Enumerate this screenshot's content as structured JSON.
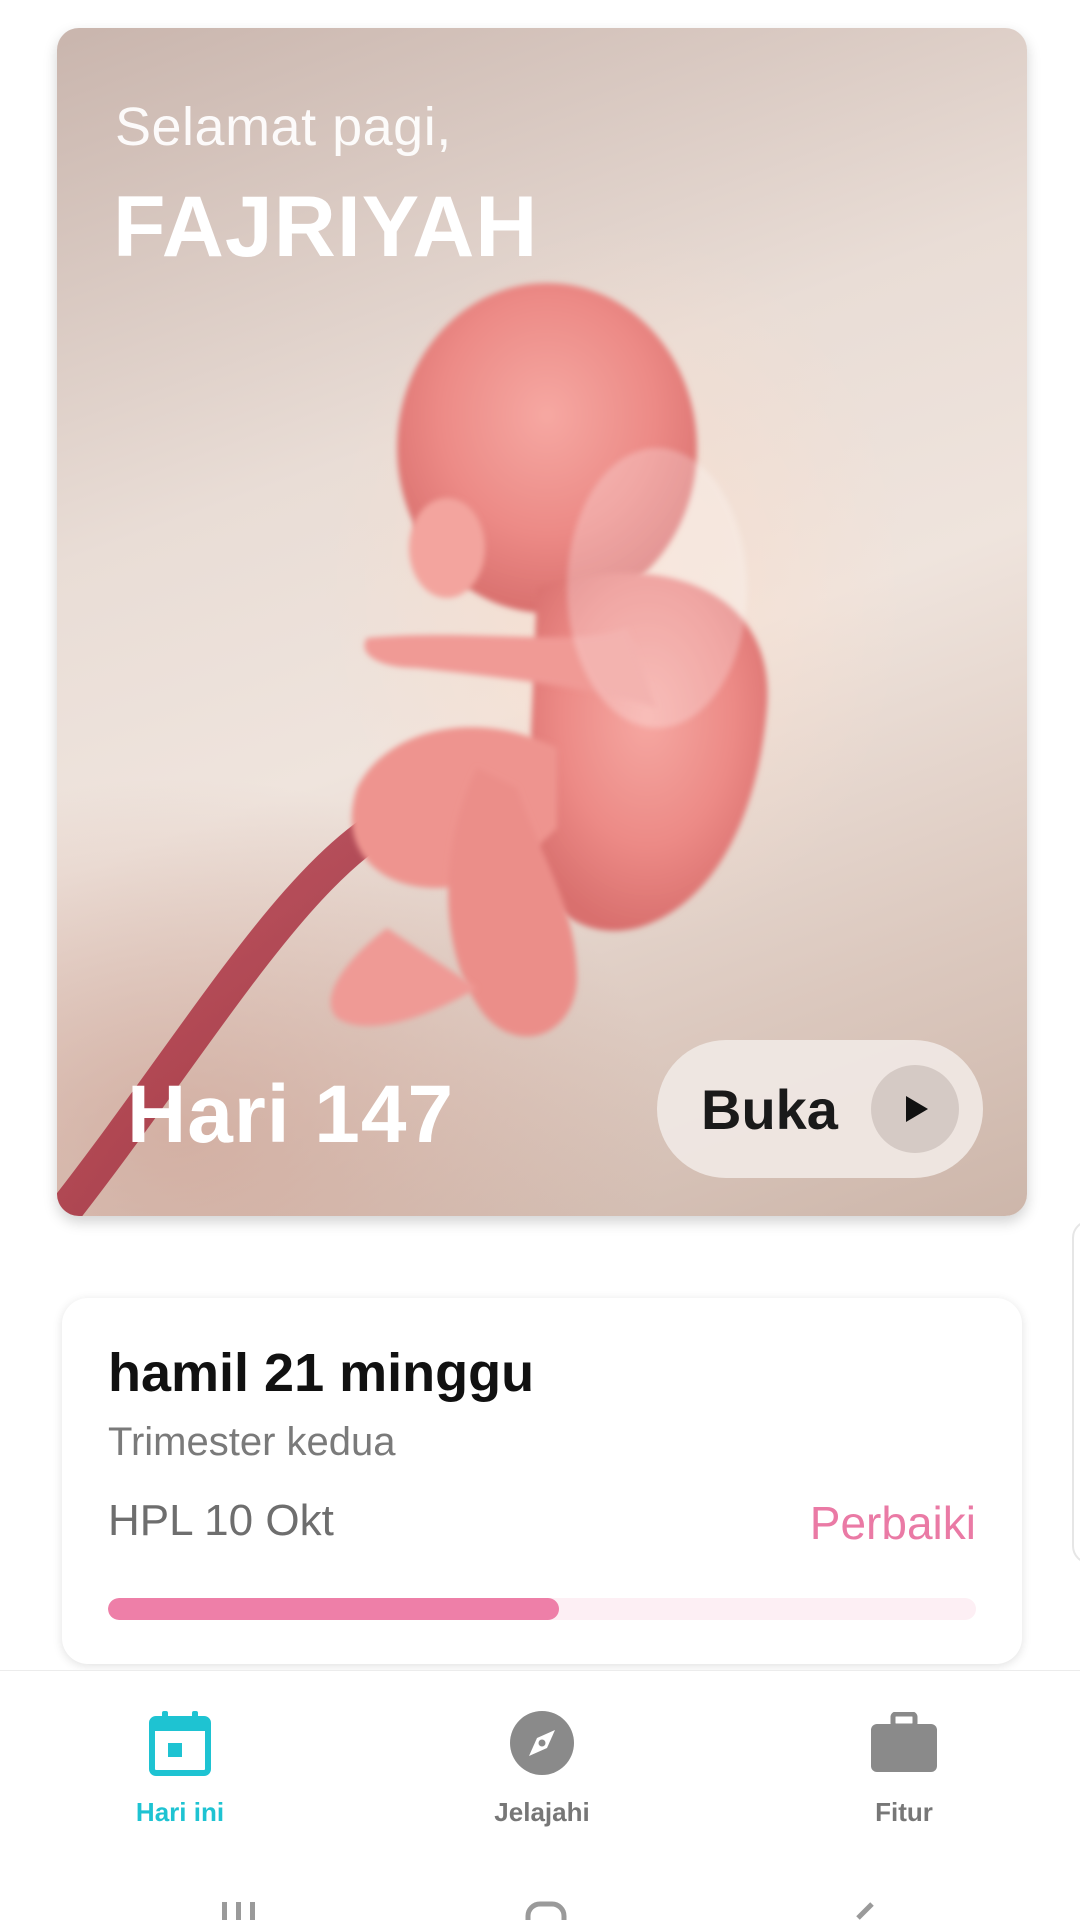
{
  "hero": {
    "greeting": "Selamat pagi,",
    "user_name": "FAJRIYAH",
    "day_label": "Hari 147",
    "open_button_label": "Buka"
  },
  "pregnancy": {
    "weeks_title": "hamil 21 minggu",
    "trimester": "Trimester kedua",
    "due_date": "HPL 10 Okt",
    "edit_label": "Perbaiki",
    "progress_fraction": 0.52
  },
  "bottom_nav": {
    "items": [
      {
        "label": "Hari ini",
        "icon": "calendar-icon",
        "active": true
      },
      {
        "label": "Jelajahi",
        "icon": "compass-icon",
        "active": false
      },
      {
        "label": "Fitur",
        "icon": "briefcase-icon",
        "active": false
      }
    ]
  },
  "colors": {
    "accent_teal": "#1ec3d2",
    "accent_pink": "#ee7fa8",
    "inactive_gray": "#777777"
  }
}
